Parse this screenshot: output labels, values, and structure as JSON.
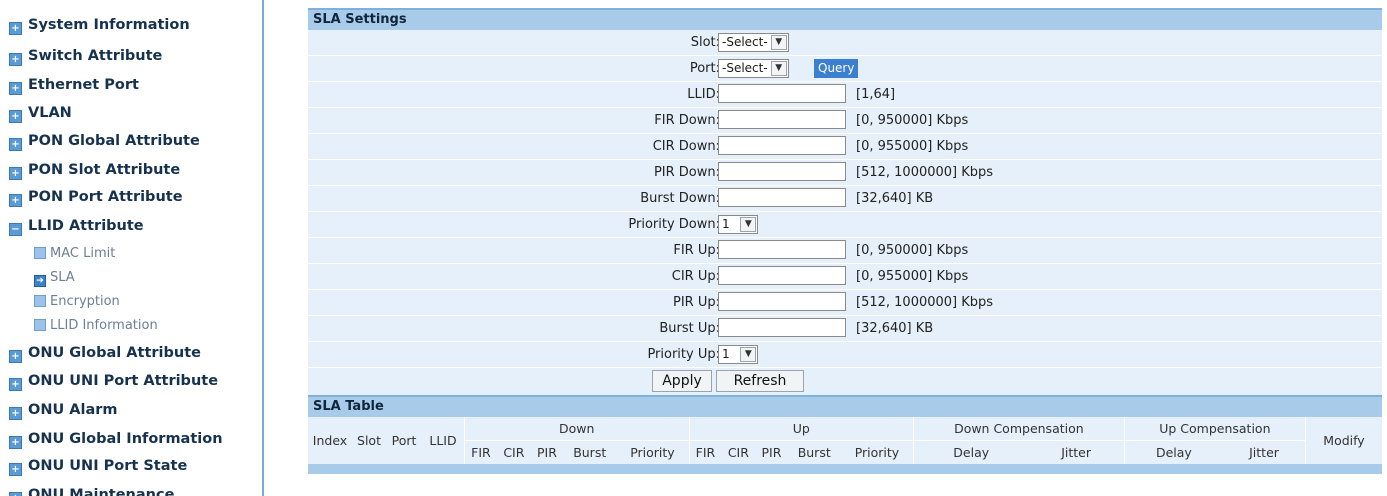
{
  "sidebar": {
    "items": [
      {
        "label": "System Information"
      },
      {
        "label": "Switch Attribute"
      },
      {
        "label": "Ethernet Port"
      },
      {
        "label": "VLAN"
      },
      {
        "label": "PON Global Attribute"
      },
      {
        "label": "PON Slot Attribute"
      },
      {
        "label": "PON Port Attribute"
      },
      {
        "label": "LLID Attribute"
      },
      {
        "label": "ONU Global Attribute"
      },
      {
        "label": "ONU UNI Port Attribute"
      },
      {
        "label": "ONU Alarm"
      },
      {
        "label": "ONU Global Information"
      },
      {
        "label": "ONU UNI Port State"
      },
      {
        "label": "ONU Maintenance"
      }
    ],
    "subitems": [
      {
        "label": "MAC Limit"
      },
      {
        "label": "SLA",
        "active": true
      },
      {
        "label": "Encryption"
      },
      {
        "label": "LLID Information"
      }
    ]
  },
  "sla_settings": {
    "title": "SLA Settings",
    "slot": {
      "label": "Slot:",
      "value": "-Select-"
    },
    "port": {
      "label": "Port:",
      "value": "-Select-"
    },
    "query_label": "Query",
    "llid": {
      "label": "LLID:",
      "hint": "[1,64]"
    },
    "fir_down": {
      "label": "FIR Down:",
      "hint": "[0, 950000] Kbps"
    },
    "cir_down": {
      "label": "CIR Down:",
      "hint": "[0, 955000] Kbps"
    },
    "pir_down": {
      "label": "PIR Down:",
      "hint": "[512, 1000000] Kbps"
    },
    "burst_down": {
      "label": "Burst Down:",
      "hint": "[32,640] KB"
    },
    "priority_down": {
      "label": "Priority Down:",
      "value": "1"
    },
    "fir_up": {
      "label": "FIR Up:",
      "hint": "[0, 950000] Kbps"
    },
    "cir_up": {
      "label": "CIR Up:",
      "hint": "[0, 955000] Kbps"
    },
    "pir_up": {
      "label": "PIR Up:",
      "hint": "[512, 1000000] Kbps"
    },
    "burst_up": {
      "label": "Burst Up:",
      "hint": "[32,640] KB"
    },
    "priority_up": {
      "label": "Priority Up:",
      "value": "1"
    },
    "apply_label": "Apply",
    "refresh_label": "Refresh"
  },
  "sla_table": {
    "title": "SLA Table",
    "headers": {
      "index": "Index",
      "slot": "Slot",
      "port": "Port",
      "llid": "LLID",
      "down": "Down",
      "up": "Up",
      "down_comp": "Down Compensation",
      "up_comp": "Up Compensation",
      "modify": "Modify",
      "fir": "FIR",
      "cir": "CIR",
      "pir": "PIR",
      "burst": "Burst",
      "priority": "Priority",
      "delay": "Delay",
      "jitter": "Jitter"
    }
  },
  "colors": {
    "header_bg": "#a9cbea",
    "row_bg": "#e6f0fa",
    "query_bg": "#3b7fd0",
    "nav_icon": "#5b9bd5"
  }
}
